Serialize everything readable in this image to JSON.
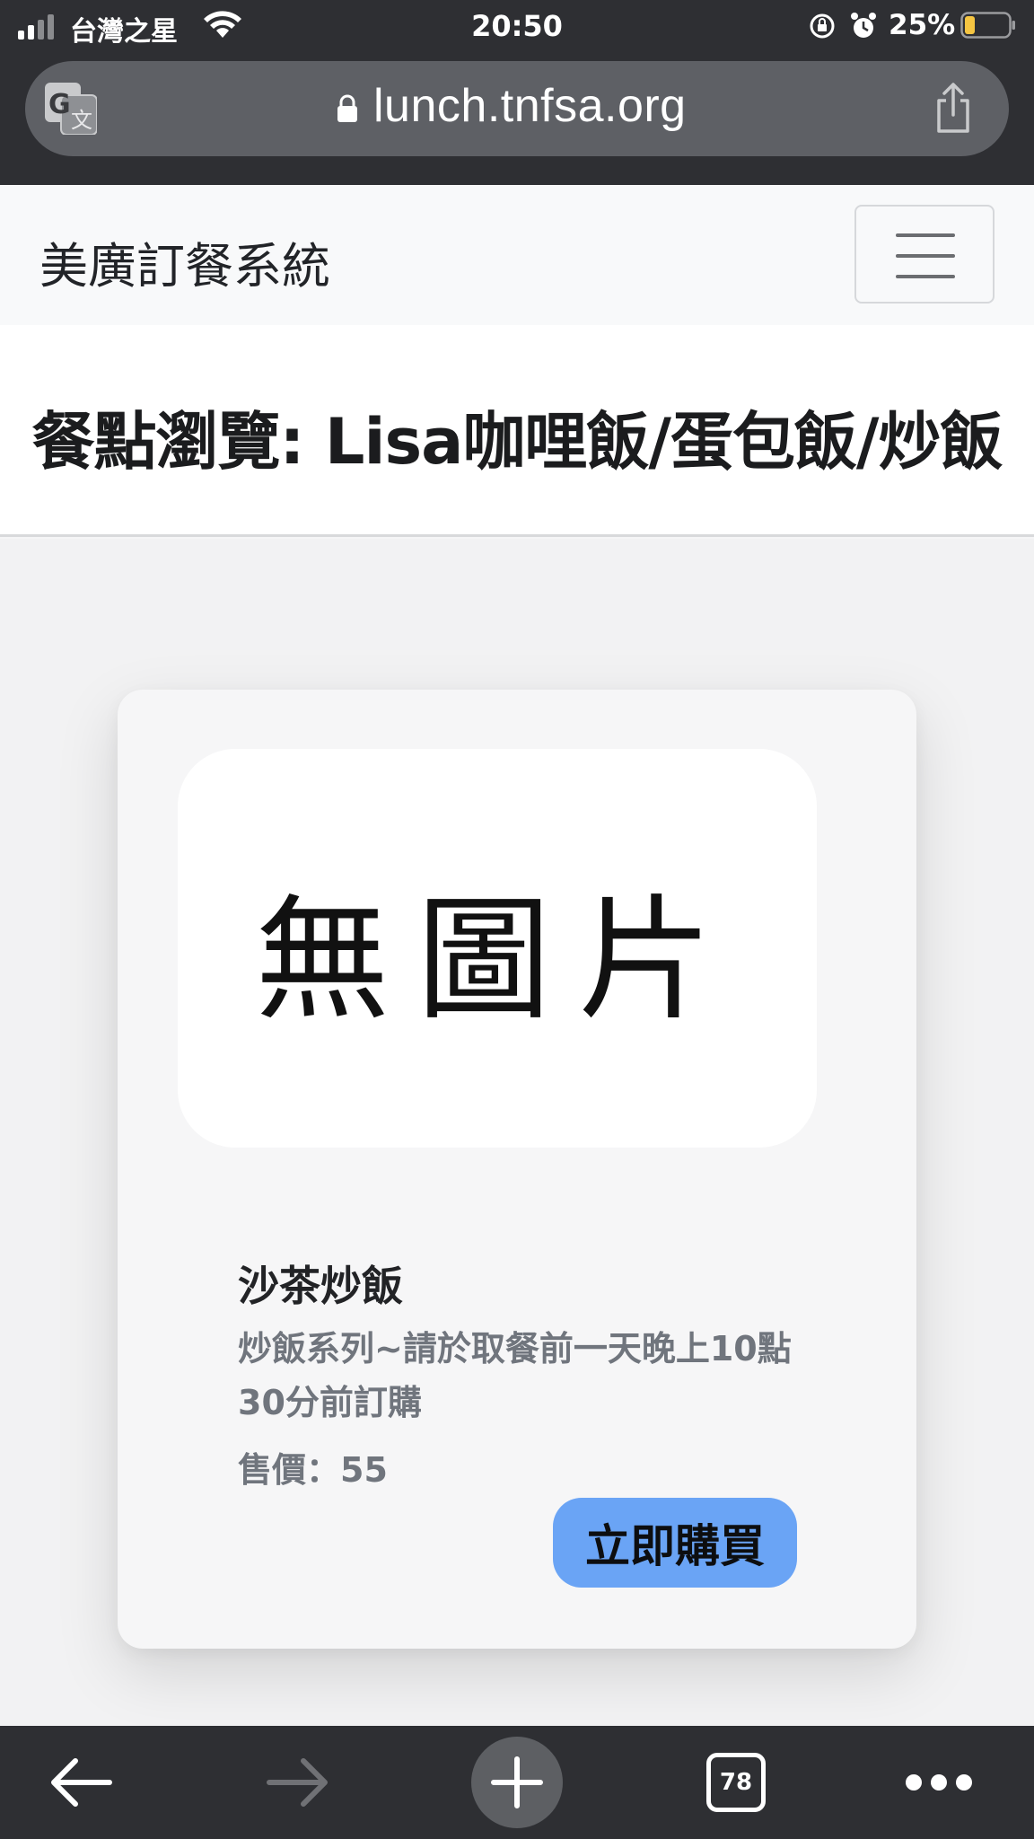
{
  "status_bar": {
    "carrier": "台灣之星",
    "time": "20:50",
    "battery_percent": "25%",
    "icons": [
      "signal-icon",
      "wifi-icon",
      "rotation-lock-icon",
      "alarm-icon",
      "battery-icon"
    ]
  },
  "browser": {
    "url": "lunch.tnfsa.org",
    "icons": [
      "translate-icon",
      "lock-icon",
      "share-icon"
    ]
  },
  "navbar": {
    "brand": "美廣訂餐系統",
    "menu_icon": "hamburger-icon"
  },
  "page": {
    "title": "餐點瀏覽: Lisa咖哩飯/蛋包飯/炒飯"
  },
  "product": {
    "image_placeholder": "無圖片",
    "name": "沙茶炒飯",
    "description": "炒飯系列~請於取餐前一天晚上10點30分前訂購",
    "price": "售價：55",
    "buy_label": "立即購買"
  },
  "toolbar": {
    "tab_count": "78",
    "icons": [
      "back-arrow-icon",
      "forward-arrow-icon",
      "plus-icon",
      "tabs-icon",
      "more-icon"
    ]
  },
  "colors": {
    "chrome_dark": "#2e2f33",
    "url_bar": "#5e6065",
    "buy_button": "#6aa4f5",
    "battery_low": "#f5c542"
  }
}
